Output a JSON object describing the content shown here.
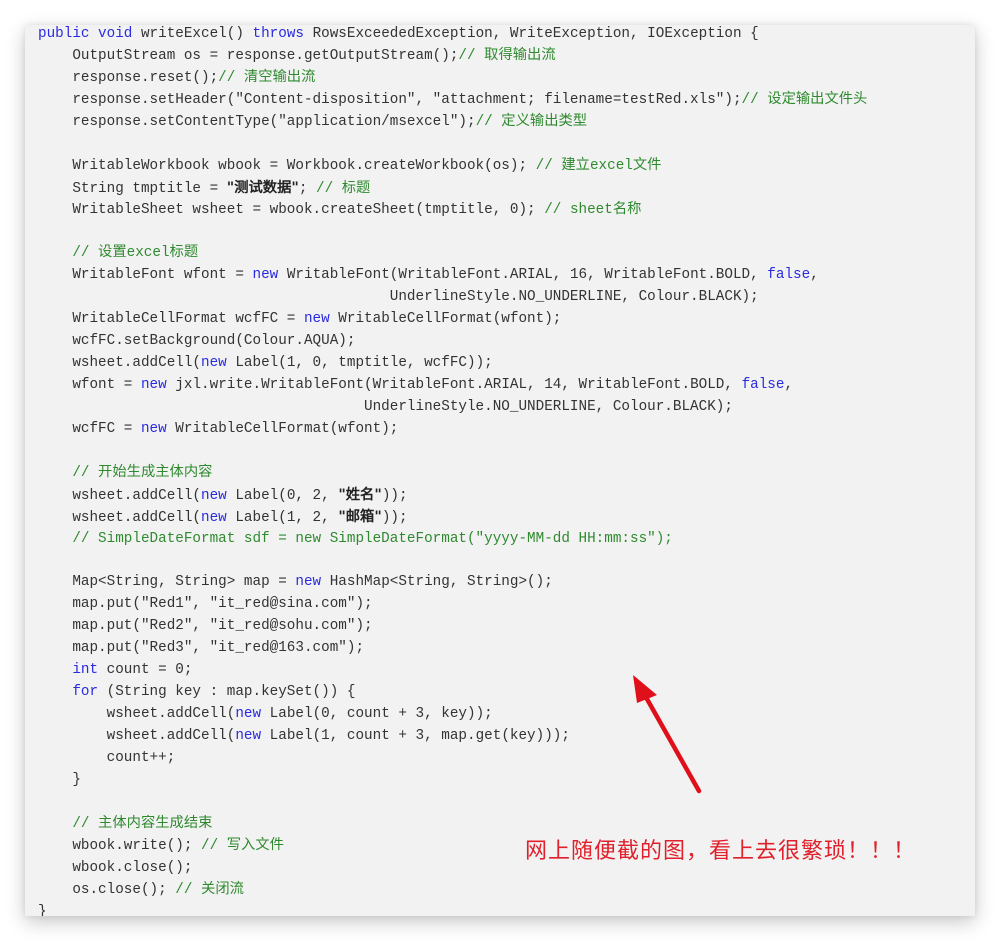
{
  "colors": {
    "keyword": "#2a2ae0",
    "comment": "#2f8a2f",
    "text": "#333333",
    "background": "#f2f2f2",
    "annotation": "#e0202a"
  },
  "code_lines": [
    [
      {
        "t": "kw",
        "v": "public void"
      },
      {
        "t": "tx",
        "v": " writeExcel() "
      },
      {
        "t": "kw",
        "v": "throws"
      },
      {
        "t": "tx",
        "v": " RowsExceededException, WriteException, IOException {"
      }
    ],
    [
      {
        "t": "tx",
        "v": "    OutputStream os = response.getOutputStream();"
      },
      {
        "t": "cm",
        "v": "// 取得输出流"
      }
    ],
    [
      {
        "t": "tx",
        "v": "    response.reset();"
      },
      {
        "t": "cm",
        "v": "// 清空输出流"
      }
    ],
    [
      {
        "t": "tx",
        "v": "    response.setHeader(\"Content-disposition\", \"attachment; filename=testRed.xls\");"
      },
      {
        "t": "cm",
        "v": "// 设定输出文件头"
      }
    ],
    [
      {
        "t": "tx",
        "v": "    response.setContentType(\"application/msexcel\");"
      },
      {
        "t": "cm",
        "v": "// 定义输出类型"
      }
    ],
    [],
    [
      {
        "t": "tx",
        "v": "    WritableWorkbook wbook = Workbook.createWorkbook(os); "
      },
      {
        "t": "cm",
        "v": "// 建立excel文件"
      }
    ],
    [
      {
        "t": "tx",
        "v": "    String tmptitle = "
      },
      {
        "t": "st",
        "v": "\"测试数据\""
      },
      {
        "t": "tx",
        "v": "; "
      },
      {
        "t": "cm",
        "v": "// 标题"
      }
    ],
    [
      {
        "t": "tx",
        "v": "    WritableSheet wsheet = wbook.createSheet(tmptitle, 0); "
      },
      {
        "t": "cm",
        "v": "// sheet名称"
      }
    ],
    [],
    [
      {
        "t": "cm",
        "v": "    // 设置excel标题"
      }
    ],
    [
      {
        "t": "tx",
        "v": "    WritableFont wfont = "
      },
      {
        "t": "kw",
        "v": "new"
      },
      {
        "t": "tx",
        "v": " WritableFont(WritableFont.ARIAL, 16, WritableFont.BOLD, "
      },
      {
        "t": "kw",
        "v": "false"
      },
      {
        "t": "tx",
        "v": ","
      }
    ],
    [
      {
        "t": "tx",
        "v": "                                         UnderlineStyle.NO_UNDERLINE, Colour.BLACK);"
      }
    ],
    [
      {
        "t": "tx",
        "v": "    WritableCellFormat wcfFC = "
      },
      {
        "t": "kw",
        "v": "new"
      },
      {
        "t": "tx",
        "v": " WritableCellFormat(wfont);"
      }
    ],
    [
      {
        "t": "tx",
        "v": "    wcfFC.setBackground(Colour.AQUA);"
      }
    ],
    [
      {
        "t": "tx",
        "v": "    wsheet.addCell("
      },
      {
        "t": "kw",
        "v": "new"
      },
      {
        "t": "tx",
        "v": " Label(1, 0, tmptitle, wcfFC));"
      }
    ],
    [
      {
        "t": "tx",
        "v": "    wfont = "
      },
      {
        "t": "kw",
        "v": "new"
      },
      {
        "t": "tx",
        "v": " jxl.write.WritableFont(WritableFont.ARIAL, 14, WritableFont.BOLD, "
      },
      {
        "t": "kw",
        "v": "false"
      },
      {
        "t": "tx",
        "v": ","
      }
    ],
    [
      {
        "t": "tx",
        "v": "                                      UnderlineStyle.NO_UNDERLINE, Colour.BLACK);"
      }
    ],
    [
      {
        "t": "tx",
        "v": "    wcfFC = "
      },
      {
        "t": "kw",
        "v": "new"
      },
      {
        "t": "tx",
        "v": " WritableCellFormat(wfont);"
      }
    ],
    [],
    [
      {
        "t": "cm",
        "v": "    // 开始生成主体内容"
      }
    ],
    [
      {
        "t": "tx",
        "v": "    wsheet.addCell("
      },
      {
        "t": "kw",
        "v": "new"
      },
      {
        "t": "tx",
        "v": " Label(0, 2, "
      },
      {
        "t": "st",
        "v": "\"姓名\""
      },
      {
        "t": "tx",
        "v": "));"
      }
    ],
    [
      {
        "t": "tx",
        "v": "    wsheet.addCell("
      },
      {
        "t": "kw",
        "v": "new"
      },
      {
        "t": "tx",
        "v": " Label(1, 2, "
      },
      {
        "t": "st",
        "v": "\"邮箱\""
      },
      {
        "t": "tx",
        "v": "));"
      }
    ],
    [
      {
        "t": "cm",
        "v": "    // SimpleDateFormat sdf = new SimpleDateFormat(\"yyyy-MM-dd HH:mm:ss\");"
      }
    ],
    [],
    [
      {
        "t": "tx",
        "v": "    Map<String, String> map = "
      },
      {
        "t": "kw",
        "v": "new"
      },
      {
        "t": "tx",
        "v": " HashMap<String, String>();"
      }
    ],
    [
      {
        "t": "tx",
        "v": "    map.put(\"Red1\", \"it_red@sina.com\");"
      }
    ],
    [
      {
        "t": "tx",
        "v": "    map.put(\"Red2\", \"it_red@sohu.com\");"
      }
    ],
    [
      {
        "t": "tx",
        "v": "    map.put(\"Red3\", \"it_red@163.com\");"
      }
    ],
    [
      {
        "t": "kw",
        "v": "    int"
      },
      {
        "t": "tx",
        "v": " count = 0;"
      }
    ],
    [
      {
        "t": "kw",
        "v": "    for"
      },
      {
        "t": "tx",
        "v": " (String key : map.keySet()) {"
      }
    ],
    [
      {
        "t": "tx",
        "v": "        wsheet.addCell("
      },
      {
        "t": "kw",
        "v": "new"
      },
      {
        "t": "tx",
        "v": " Label(0, count + 3, key));"
      }
    ],
    [
      {
        "t": "tx",
        "v": "        wsheet.addCell("
      },
      {
        "t": "kw",
        "v": "new"
      },
      {
        "t": "tx",
        "v": " Label(1, count + 3, map.get(key)));"
      }
    ],
    [
      {
        "t": "tx",
        "v": "        count++;"
      }
    ],
    [
      {
        "t": "tx",
        "v": "    }"
      }
    ],
    [],
    [
      {
        "t": "cm",
        "v": "    // 主体内容生成结束"
      }
    ],
    [
      {
        "t": "tx",
        "v": "    wbook.write(); "
      },
      {
        "t": "cm",
        "v": "// 写入文件"
      }
    ],
    [
      {
        "t": "tx",
        "v": "    wbook.close();"
      }
    ],
    [
      {
        "t": "tx",
        "v": "    os.close(); "
      },
      {
        "t": "cm",
        "v": "// 关闭流"
      }
    ],
    [
      {
        "t": "tx",
        "v": "}"
      }
    ]
  ],
  "annotation": {
    "text": "网上随便截的图，看上去很繁琐！！！",
    "icon": "red-arrow-icon"
  }
}
